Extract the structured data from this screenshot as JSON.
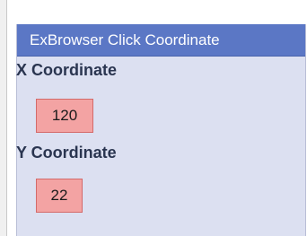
{
  "panel": {
    "title": "ExBrowser Click Coordinate",
    "x_label": "X Coordinate",
    "x_value": "120",
    "y_label": "Y Coordinate",
    "y_value": "22"
  },
  "colors": {
    "header_bg": "#5b77c5",
    "panel_bg": "#dce0f1",
    "value_box_bg": "#f3a3a3",
    "value_box_border": "#d46a6a"
  }
}
